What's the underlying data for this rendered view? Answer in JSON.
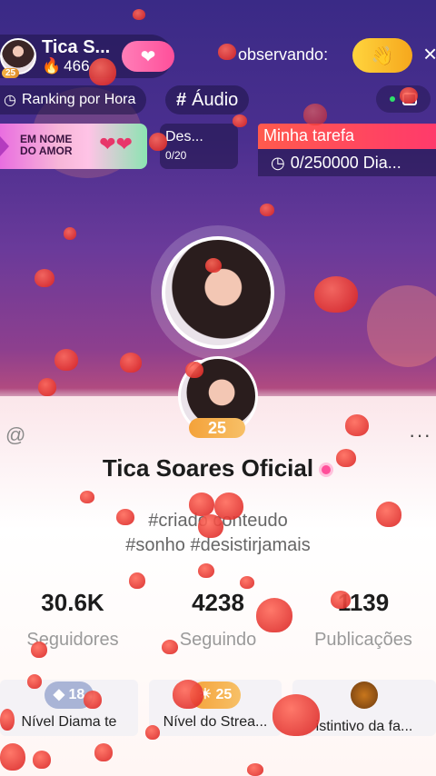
{
  "host": {
    "name": "Tica S...",
    "score": "466",
    "level": "25"
  },
  "header": {
    "observing_label": "observando:",
    "close_glyph": "×"
  },
  "tags": {
    "ranking": "Ranking por Hora",
    "audio": "Áudio"
  },
  "banner": {
    "line1": "EM NOME",
    "line2": "DO AMOR"
  },
  "task_card": {
    "name": "Des...",
    "progress": "0/20"
  },
  "my_task": {
    "title": "Minha tarefa",
    "progress": "0/250000 Dia..."
  },
  "profile": {
    "name": "Tica Soares Oficial",
    "level": "25",
    "bio_line1": "#criado     conteudo",
    "bio_line2": "#sonho #desistirjamais",
    "at_glyph": "@",
    "more_glyph": "···"
  },
  "stats": [
    {
      "value": "30.6K",
      "label": "Seguidores"
    },
    {
      "value": "4238",
      "label": "Seguindo"
    },
    {
      "value": "1139",
      "label": "Publicações"
    }
  ],
  "badges": [
    {
      "value": "18",
      "label": "Nível Diama    te"
    },
    {
      "value": "25",
      "label": "Nível do Strea..."
    },
    {
      "value": "",
      "label": "istintivo da fa..."
    }
  ],
  "colors": {
    "follow": "#ff4f9a",
    "wave": "#f6a71d",
    "task_header": "#ff3a6b",
    "level": "#f4a23a"
  },
  "icons": {
    "follow": "heart-icon",
    "wave": "hand-wave-icon",
    "score": "flame-icon",
    "ranking": "clock-icon",
    "task_timer": "clock-icon"
  }
}
